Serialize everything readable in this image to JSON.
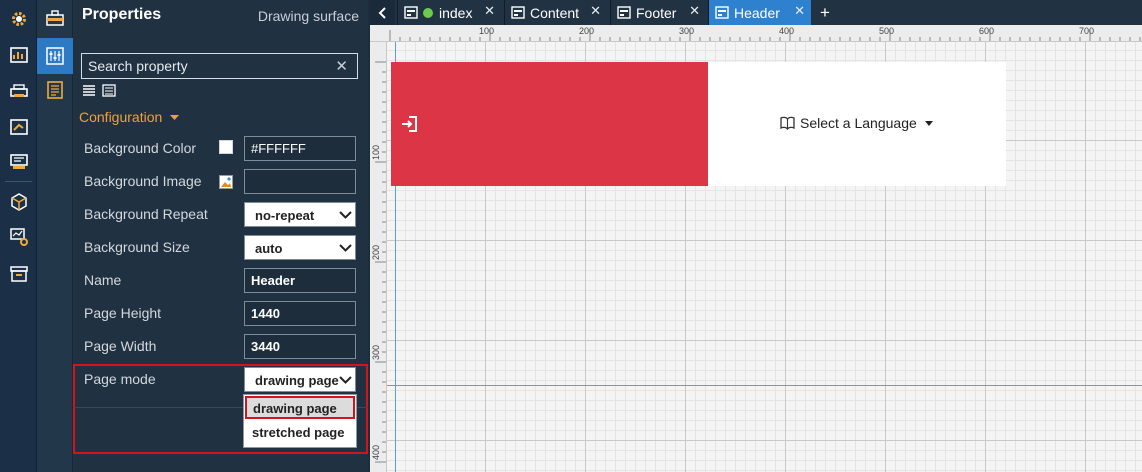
{
  "rail": {
    "icons": [
      "settings-gear-icon",
      "chart-icon",
      "printer-icon",
      "export-chart-icon",
      "dashboard-icon",
      "cube-icon",
      "monitor-settings-icon",
      "archive-icon"
    ]
  },
  "panel": {
    "title": "Properties",
    "subtitle": "Drawing surface",
    "search_placeholder": "Search property",
    "search_clear": "✕",
    "section": "Configuration",
    "props": {
      "bg_color_label": "Background Color",
      "bg_color_value": "#FFFFFF",
      "bg_image_label": "Background Image",
      "bg_image_value": "",
      "bg_repeat_label": "Background Repeat",
      "bg_repeat_value": "no-repeat",
      "bg_size_label": "Background Size",
      "bg_size_value": "auto",
      "name_label": "Name",
      "name_value": "Header",
      "page_height_label": "Page Height",
      "page_height_value": "1440",
      "page_width_label": "Page Width",
      "page_width_value": "3440",
      "page_mode_label": "Page mode",
      "page_mode_value": "drawing page"
    },
    "page_mode_options": [
      "drawing page",
      "stretched page"
    ]
  },
  "tabs": [
    {
      "label": "index",
      "has_status_dot": true,
      "close": "✕"
    },
    {
      "label": "Content",
      "close": "✕"
    },
    {
      "label": "Footer",
      "close": "✕"
    },
    {
      "label": "Header",
      "active": true,
      "close": "✕"
    }
  ],
  "tab_add": "+",
  "ruler": {
    "top": [
      "100",
      "200",
      "300",
      "400",
      "500",
      "600",
      "700"
    ],
    "left": [
      "100",
      "200",
      "300",
      "400"
    ]
  },
  "canvas": {
    "language_selector": "Select a Language",
    "header_color": "#DC3545"
  },
  "colors": {
    "accent": "#2D81CF",
    "highlight": "#D3141A",
    "config_orange": "#F0A13A"
  }
}
